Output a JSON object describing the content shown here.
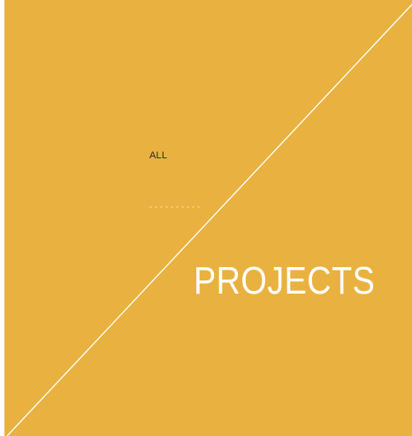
{
  "panel": {
    "background_color": "#e9b13f",
    "diagonal_color": "#ffffff"
  },
  "nav": {
    "all_label": "ALL"
  },
  "hero": {
    "title": "PROJECTS"
  }
}
